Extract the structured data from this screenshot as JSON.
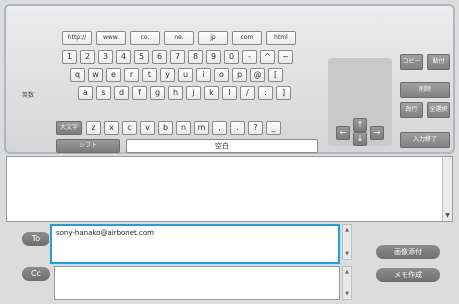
{
  "url_keys": [
    "http://",
    "www.",
    "co.",
    "ne.",
    "jp",
    "com",
    "html"
  ],
  "row1": [
    "1",
    "2",
    "3",
    "4",
    "5",
    "6",
    "7",
    "8",
    "9",
    "0",
    "-",
    "^",
    "~"
  ],
  "row2": [
    "q",
    "w",
    "e",
    "r",
    "t",
    "y",
    "u",
    "i",
    "o",
    "p",
    "@",
    "["
  ],
  "row3": [
    "a",
    "s",
    "d",
    "f",
    "g",
    "h",
    "j",
    "k",
    "l",
    "/",
    ":",
    "]"
  ],
  "row4": [
    "z",
    "x",
    "c",
    "v",
    "b",
    "n",
    "m",
    ",",
    ".",
    "?",
    "_"
  ],
  "mode_label": "英数",
  "caps_label": "大文字",
  "shift_label": "シフト",
  "space_label": "空白",
  "arrows": {
    "left": "←",
    "up": "↑",
    "right": "→",
    "down": "↓"
  },
  "right_keys": {
    "copy": "コピー",
    "paste": "貼付",
    "delete": "削除",
    "newline": "改行",
    "select_all": "全選択",
    "done": "入力終了"
  },
  "body_text": "",
  "to": {
    "label": "To",
    "value": "sony-hanako@airbonet.com"
  },
  "cc": {
    "label": "Cc",
    "value": ""
  },
  "buttons": {
    "attach_image": "画像添付",
    "create_memo": "メモ作成"
  }
}
